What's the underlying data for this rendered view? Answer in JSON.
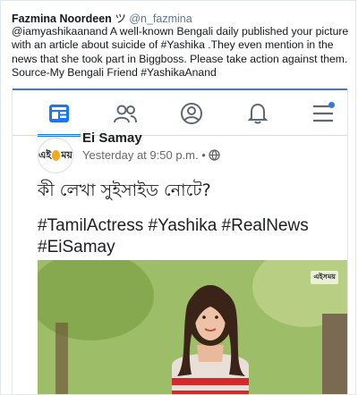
{
  "tweet": {
    "author_name": "Fazmina Noordeen",
    "author_symbol": "ツ",
    "author_handle": "@n_fazmina",
    "text": "@iamyashikaanand A well-known Bengali daily published your picture with an article about suicide of #Yashika .They even mention in the news that she took part in Biggboss. Please take action against them. Source-My Bengali Friend #YashikaAnand"
  },
  "facebook": {
    "nav_icons": [
      "news-feed-icon",
      "friends-icon",
      "profile-icon",
      "notifications-icon",
      "menu-icon"
    ],
    "accent_color": "#1877f2",
    "post": {
      "page_name": "Ei Samay",
      "logo_text_left": "এই",
      "logo_text_right": "ময়",
      "timestamp": "Yesterday at 9:50 p.m. •",
      "privacy_icon": "globe-icon",
      "line1": "কী লেখা সুইসাইড নোটে?",
      "hashtags": "#TamilActress #Yashika #RealNews #EiSamay",
      "image_watermark": "এইসময়"
    }
  }
}
